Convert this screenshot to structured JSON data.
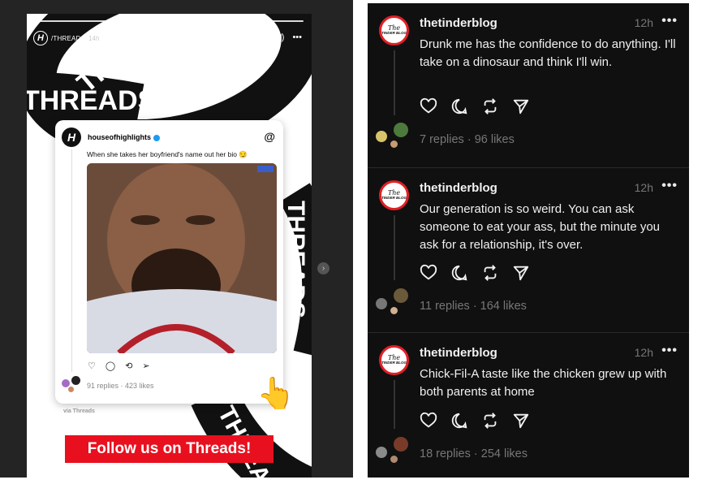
{
  "story": {
    "account": "/THREADS",
    "time": "14h",
    "ring_word": "THREADS",
    "card": {
      "username": "houseofhighlights",
      "text": "When she takes her boyfriend's name out her bio 😏",
      "stats": "91 replies · 423 likes"
    },
    "via": "via Threads",
    "banner": "Follow us on Threads!",
    "hand": "👆"
  },
  "posts": [
    {
      "username": "thetinderblog",
      "time": "12h",
      "text": "Drunk me has the confidence to do anything. I'll take on a dinosaur and think I'll win.",
      "stats": "7 replies · 96 likes"
    },
    {
      "username": "thetinderblog",
      "time": "12h",
      "text": "Our generation is so weird. You can ask someone to eat your ass, but the minute you ask for a relationship, it's over.",
      "stats": "11 replies · 164 likes"
    },
    {
      "username": "thetinderblog",
      "time": "12h",
      "text": "Chick-Fil-A taste like the chicken grew up with both parents at home",
      "stats": "18 replies · 254 likes"
    }
  ],
  "avatar_text": {
    "top": "The",
    "bottom": "TINDER BLOG"
  },
  "icons": {
    "more": "•••",
    "next": "›"
  },
  "colors": {
    "brand_red": "#e21f26",
    "banner_red": "#e8101f",
    "dark_bg": "#101010"
  }
}
